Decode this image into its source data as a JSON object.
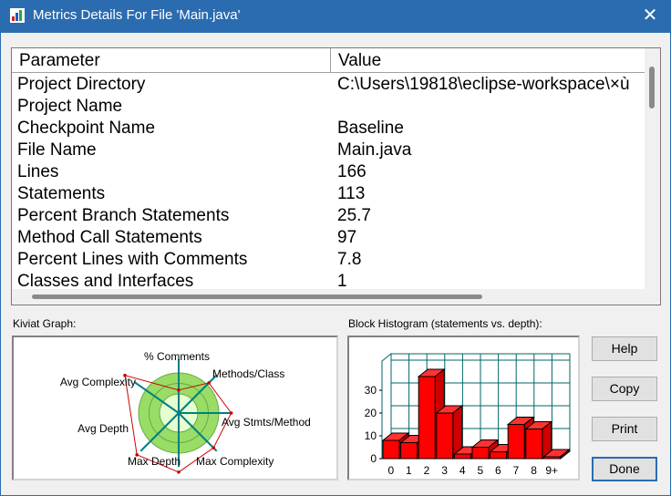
{
  "window": {
    "title": "Metrics Details For File 'Main.java'",
    "close_glyph": "✕"
  },
  "table": {
    "headers": {
      "parameter": "Parameter",
      "value": "Value"
    },
    "rows": [
      {
        "parameter": "Project Directory",
        "value": "C:\\Users\\19818\\eclipse-workspace\\×ù"
      },
      {
        "parameter": "Project Name",
        "value": ""
      },
      {
        "parameter": "Checkpoint Name",
        "value": "Baseline"
      },
      {
        "parameter": "File Name",
        "value": "Main.java"
      },
      {
        "parameter": "Lines",
        "value": "166"
      },
      {
        "parameter": "Statements",
        "value": "113"
      },
      {
        "parameter": "Percent Branch Statements",
        "value": "25.7"
      },
      {
        "parameter": "Method Call Statements",
        "value": "97"
      },
      {
        "parameter": "Percent Lines with Comments",
        "value": "7.8"
      },
      {
        "parameter": "Classes and Interfaces",
        "value": "1"
      }
    ]
  },
  "kiviat": {
    "label": "Kiviat Graph:",
    "axes": [
      "% Comments",
      "Methods/Class",
      "Avg Stmts/Method",
      "Max Complexity",
      "Max Depth",
      "Avg Depth",
      "Avg Complexity"
    ],
    "levels": [
      0.35,
      0.65,
      0.8,
      0.75,
      0.9,
      0.9,
      1.0
    ]
  },
  "histogram": {
    "label": "Block Histogram (statements vs. depth):",
    "categories": [
      "0",
      "1",
      "2",
      "3",
      "4",
      "5",
      "6",
      "7",
      "8",
      "9+"
    ],
    "values": [
      8,
      7,
      36,
      20,
      2,
      5,
      3,
      15,
      13,
      0
    ],
    "yticks": [
      "0",
      "10",
      "20",
      "30"
    ],
    "ylim": [
      0,
      40
    ],
    "bar_color": "#ff0000"
  },
  "buttons": {
    "help": "Help",
    "copy": "Copy",
    "print": "Print",
    "done": "Done"
  },
  "colors": {
    "titlebar": "#2b6cb0",
    "kiviat_ring": "#99dd66",
    "kiviat_spoke": "#008080",
    "kiviat_poly": "#cc0000"
  }
}
